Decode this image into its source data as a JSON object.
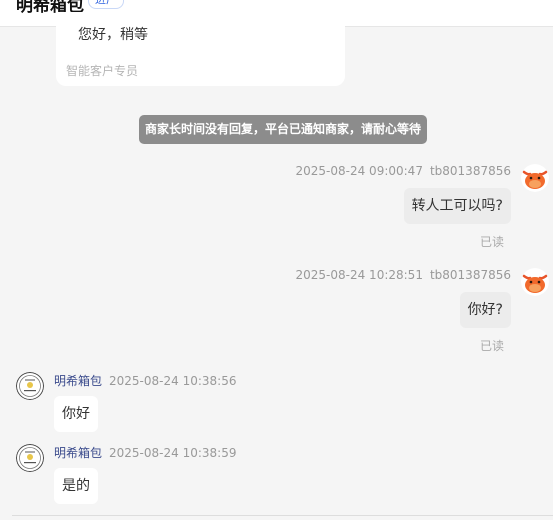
{
  "header": {
    "shop_name": "明希箱包",
    "badge": "进广"
  },
  "system_card": {
    "text": "您好，稍等",
    "footer": "智能客户专员"
  },
  "notice": "商家长时间没有回复，平台已通知商家，请耐心等待",
  "messages": [
    {
      "time": "2025-08-24 09:00:47",
      "user": "tb801387856",
      "text": "转人工可以吗?",
      "status": "已读",
      "avatar": "cow-avatar-icon"
    },
    {
      "time": "2025-08-24 10:28:51",
      "user": "tb801387856",
      "text": "你好?",
      "status": "已读",
      "avatar": "cow-avatar-icon"
    },
    {
      "sender": "明希箱包",
      "time": "2025-08-24 10:38:56",
      "text": "你好",
      "avatar": "shop-logo-icon"
    },
    {
      "sender": "明希箱包",
      "time": "2025-08-24 10:38:59",
      "text": "是的",
      "avatar": "shop-logo-icon"
    }
  ]
}
